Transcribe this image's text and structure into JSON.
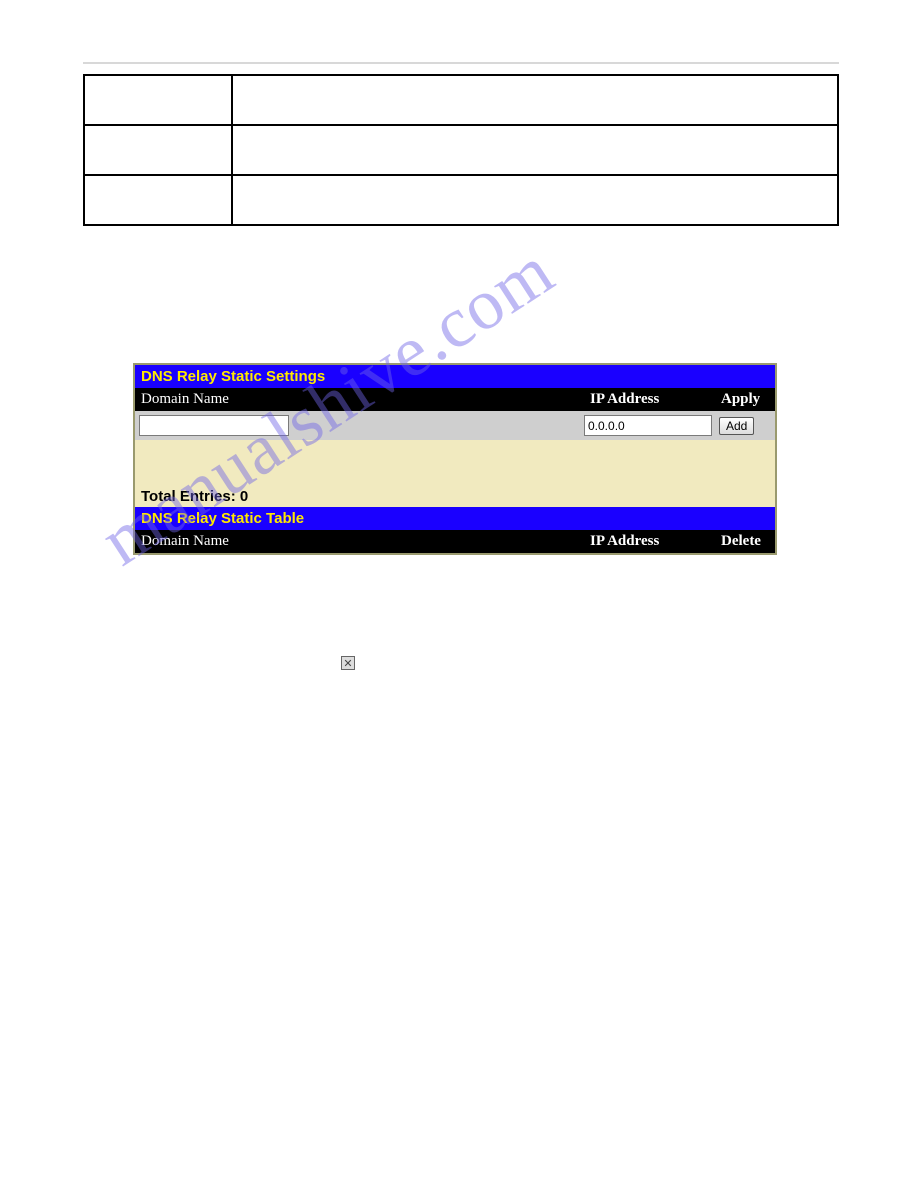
{
  "watermark_text": "manualshive.com",
  "param_table": {
    "rows": [
      {
        "label": "",
        "desc": ""
      },
      {
        "label": "",
        "desc": ""
      },
      {
        "label": "",
        "desc": ""
      }
    ]
  },
  "panel": {
    "settings_title": "DNS Relay Static Settings",
    "settings_headers": {
      "domain": "Domain Name",
      "ip": "IP Address",
      "apply": "Apply"
    },
    "input_row": {
      "domain_value": "",
      "ip_value": "0.0.0.0",
      "add_button_label": "Add"
    },
    "total_entries_label": "Total Entries: 0",
    "table_title": "DNS Relay Static Table",
    "table_headers": {
      "domain": "Domain Name",
      "ip": "IP Address",
      "del": "Delete"
    }
  },
  "delete_icon_glyph": "✕"
}
